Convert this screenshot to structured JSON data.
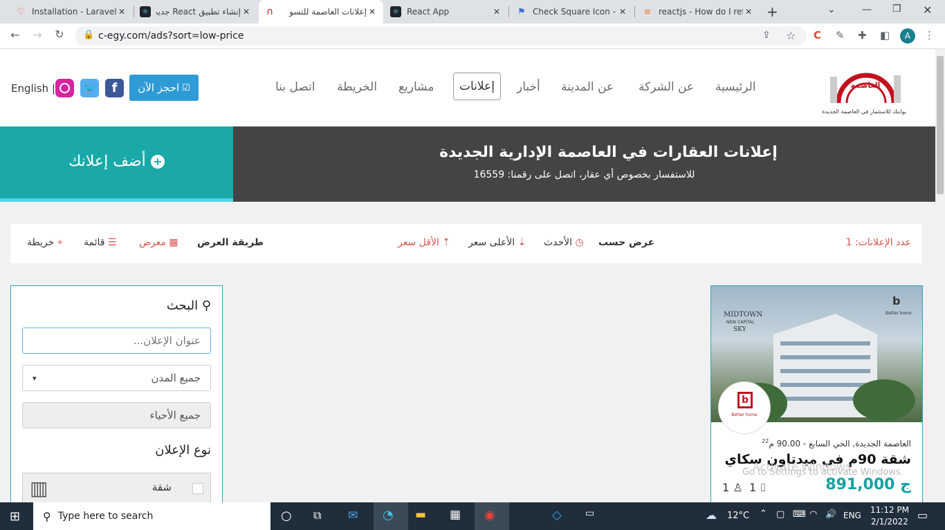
{
  "browser": {
    "tabs": [
      {
        "title": "Installation - Laravel -",
        "favicon": "laravel-icon",
        "color": "#f55247"
      },
      {
        "title": "إنشاء تطبيق React جديد",
        "favicon": "react-icon",
        "color": "#20232a"
      },
      {
        "title": "إعلانات العاصمة للتسو",
        "favicon": "capital-icon",
        "color": "#c1121f"
      },
      {
        "title": "React App",
        "favicon": "react-icon",
        "color": "#20232a"
      },
      {
        "title": "Check Square Icon - R",
        "favicon": "flag-icon",
        "color": "#3b6fd4"
      },
      {
        "title": "reactjs - How do I refe",
        "favicon": "stackoverflow-icon",
        "color": "#f48024"
      }
    ],
    "tab_close": "✕",
    "new_tab": "+",
    "url": "c-egy.com/ads?sort=low-price",
    "profile_initial": "A"
  },
  "site": {
    "logo_text": "العاصمة",
    "logo_tagline": "بوابتك للاستثمار في العاصمة الجديدة",
    "nav": [
      "الرئيسية",
      "عن الشركة",
      "عن المدينة",
      "أخبار",
      "إعلانات",
      "مشاريع",
      "الخريطة",
      "اتصل بنا"
    ],
    "book_button": "احجز الآن",
    "lang": "English |",
    "banner_title": "إعلانات العقارات في العاصمة الإدارية الجديدة",
    "banner_sub": "للاستفسار بخصوص أي عقار، اتصل على رقمنا: 16559",
    "add_ad": "أضف إعلانك",
    "sort": {
      "count_label": "عدد الإعلانات: 1",
      "sort_by": "عرض حسب",
      "newest": "الأحدث",
      "highest": "الأعلى سعر",
      "lowest": "الأقل سعر",
      "view_mode": "طريقة العرض",
      "gallery": "معرض",
      "list": "قائمة",
      "map": "خريطة"
    },
    "search": {
      "title": "البحث",
      "title_placeholder": "عنوان الإعلان...",
      "cities": "جميع المدن",
      "districts": "جميع الأحياء",
      "ad_type": "نوع الإعلان",
      "type_apartment": "شقة"
    },
    "card": {
      "brand_top": "MIDTOWN",
      "brand_sub": "NEW CAPITAL",
      "brand_sky": "SKY",
      "brand_right": "Better home",
      "location_prefix": "العاصمة الجديدة, الحي السابع - 90.00 م",
      "location_sup": "22",
      "title": "شقة 90م في ميدتاون سكاي",
      "price": "891,000",
      "currency": "ج",
      "baths": "1",
      "beds": "1",
      "watermark1": "Activate Windows",
      "watermark2": "Go to Settings to activate Windows."
    }
  },
  "taskbar": {
    "search_placeholder": "Type here to search",
    "temp": "12°C",
    "lang": "ENG",
    "time": "11:12 PM",
    "date": "2/1/2022"
  }
}
